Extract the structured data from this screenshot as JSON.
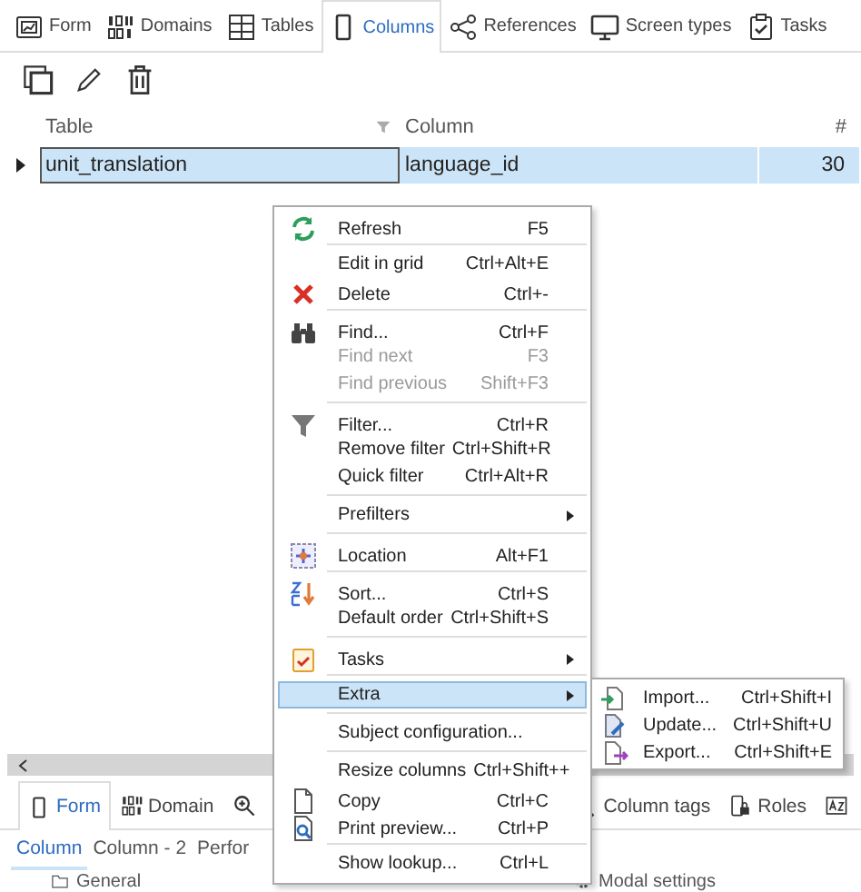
{
  "top_tabs": [
    {
      "label": "Form",
      "selected": false
    },
    {
      "label": "Domains",
      "selected": false
    },
    {
      "label": "Tables",
      "selected": false
    },
    {
      "label": "Columns",
      "selected": true
    },
    {
      "label": "References",
      "selected": false
    },
    {
      "label": "Screen types",
      "selected": false
    },
    {
      "label": "Tasks",
      "selected": false
    }
  ],
  "grid": {
    "columns": [
      "Table",
      "Column",
      "#"
    ],
    "rows": [
      {
        "cells": [
          "unit_translation",
          "language_id",
          "30"
        ],
        "selected": true
      }
    ]
  },
  "context_menu": {
    "items": [
      {
        "kind": "item",
        "label": "Refresh",
        "shortcut": "F5",
        "disabled": false,
        "submenu": false,
        "selected": false
      },
      {
        "kind": "separator"
      },
      {
        "kind": "item",
        "label": "Edit in grid",
        "shortcut": "Ctrl+Alt+E",
        "disabled": false,
        "submenu": false,
        "selected": false
      },
      {
        "kind": "item",
        "label": "Delete",
        "shortcut": "Ctrl+-",
        "disabled": false,
        "submenu": false,
        "selected": false
      },
      {
        "kind": "separator"
      },
      {
        "kind": "item",
        "label": "Find...",
        "shortcut": "Ctrl+F",
        "disabled": false,
        "submenu": false,
        "selected": false
      },
      {
        "kind": "item",
        "label": "Find next",
        "shortcut": "F3",
        "disabled": true,
        "submenu": false,
        "selected": false
      },
      {
        "kind": "item",
        "label": "Find previous",
        "shortcut": "Shift+F3",
        "disabled": true,
        "submenu": false,
        "selected": false
      },
      {
        "kind": "separator"
      },
      {
        "kind": "item",
        "label": "Filter...",
        "shortcut": "Ctrl+R",
        "disabled": false,
        "submenu": false,
        "selected": false
      },
      {
        "kind": "item",
        "label": "Remove filter",
        "shortcut": "Ctrl+Shift+R",
        "disabled": false,
        "submenu": false,
        "selected": false
      },
      {
        "kind": "item",
        "label": "Quick filter",
        "shortcut": "Ctrl+Alt+R",
        "disabled": false,
        "submenu": false,
        "selected": false
      },
      {
        "kind": "separator"
      },
      {
        "kind": "item",
        "label": "Prefilters",
        "disabled": false,
        "submenu": true,
        "selected": false
      },
      {
        "kind": "separator"
      },
      {
        "kind": "item",
        "label": "Location",
        "shortcut": "Alt+F1",
        "disabled": false,
        "submenu": false,
        "selected": false
      },
      {
        "kind": "separator"
      },
      {
        "kind": "item",
        "label": "Sort...",
        "shortcut": "Ctrl+S",
        "disabled": false,
        "submenu": false,
        "selected": false
      },
      {
        "kind": "item",
        "label": "Default order",
        "shortcut": "Ctrl+Shift+S",
        "disabled": false,
        "submenu": false,
        "selected": false
      },
      {
        "kind": "separator"
      },
      {
        "kind": "item",
        "label": "Tasks",
        "disabled": false,
        "submenu": true,
        "selected": false
      },
      {
        "kind": "separator"
      },
      {
        "kind": "item",
        "label": "Extra",
        "disabled": false,
        "submenu": true,
        "selected": true
      },
      {
        "kind": "separator"
      },
      {
        "kind": "item",
        "label": "Subject configuration...",
        "disabled": false,
        "submenu": false,
        "selected": false
      },
      {
        "kind": "separator"
      },
      {
        "kind": "item",
        "label": "Resize columns",
        "shortcut": "Ctrl+Shift++",
        "disabled": false,
        "submenu": false,
        "selected": false
      },
      {
        "kind": "item",
        "label": "Copy",
        "shortcut": "Ctrl+C",
        "disabled": false,
        "submenu": false,
        "selected": false
      },
      {
        "kind": "item",
        "label": "Print preview...",
        "shortcut": "Ctrl+P",
        "disabled": false,
        "submenu": false,
        "selected": false
      },
      {
        "kind": "separator"
      },
      {
        "kind": "item",
        "label": "Show lookup...",
        "shortcut": "Ctrl+L",
        "disabled": false,
        "submenu": false,
        "selected": false
      }
    ]
  },
  "submenu": {
    "items": [
      {
        "label": "Import...",
        "shortcut": "Ctrl+Shift+I"
      },
      {
        "label": "Update...",
        "shortcut": "Ctrl+Shift+U"
      },
      {
        "label": "Export...",
        "shortcut": "Ctrl+Shift+E"
      }
    ]
  },
  "bottom_tabs": [
    {
      "label": "Form",
      "selected": true
    },
    {
      "label": "Domain",
      "selected": false
    },
    {
      "label": "Column tags",
      "selected": false
    },
    {
      "label": "Roles",
      "selected": false
    }
  ],
  "sub_tabs": [
    {
      "label": "Column",
      "selected": true
    },
    {
      "label": "Column - 2",
      "selected": false
    },
    {
      "label": "Perfor",
      "selected": false
    }
  ],
  "sections": [
    "General",
    "Modal settings"
  ]
}
